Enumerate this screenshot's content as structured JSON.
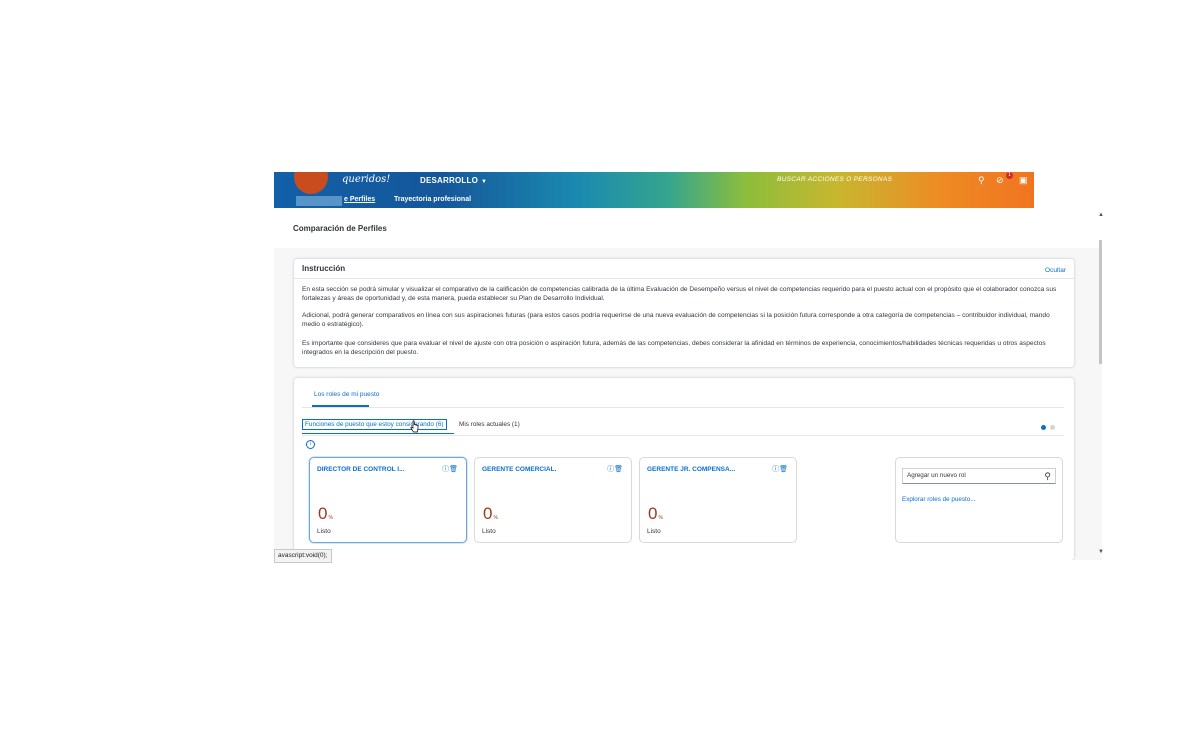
{
  "header": {
    "logo_text": "queridos!",
    "module": "DESARROLLO",
    "search_placeholder": "BUSCAR ACCIONES O PERSONAS",
    "notification_count": "1",
    "colors": {
      "accent": "#0a6ed1",
      "value": "#9b3a1e",
      "badge": "#d3282d"
    }
  },
  "subnav": {
    "tabs": [
      {
        "label": "e Perfiles"
      },
      {
        "label": "Trayectoria profesional"
      }
    ]
  },
  "page": {
    "title": "Comparación de Perfiles"
  },
  "instruction": {
    "heading": "Instrucción",
    "hide_link": "Ocultar",
    "paragraphs": [
      "En esta sección se podrá simular y visualizar el comparativo de la calificación de competencias calibrada de la última Evaluación de Desempeño versus el nivel de competencias requerido para el puesto actual con el propósito que el colaborador conozca sus fortalezas y áreas de oportunidad y, de esta manera, pueda establecer su Plan de Desarrollo Individual.",
      "Adicional, podrá generar comparativos en línea con sus aspiraciones futuras (para estos casos podría requerirse de una nueva evaluación de competencias si la posición futura corresponde a otra categoría de competencias – contribuidor individual, mando medio o estratégico).",
      "Es importante que consideres que para evaluar el nivel de ajuste con otra posición o aspiración futura, además de las competencias, debes considerar la afinidad en términos de experiencia, conocimientos/habilidades técnicas requeridas u otros aspectos integrados en la descripción del puesto."
    ]
  },
  "roles": {
    "tab": "Los roles de mi puesto",
    "segments": [
      {
        "label": "Funciones de puesto que estoy considerando (6)"
      },
      {
        "label": "Mis roles actuales (1)"
      }
    ],
    "cards": [
      {
        "title": "DIRECTOR DE CONTROL I...",
        "value": "0",
        "unit": "%",
        "status": "Listo"
      },
      {
        "title": "GERENTE COMERCIAL.",
        "value": "0",
        "unit": "%",
        "status": "Listo"
      },
      {
        "title": "GERENTE JR. COMPENSA...",
        "value": "0",
        "unit": "%",
        "status": "Listo"
      }
    ],
    "add": {
      "placeholder": "Agregar un nuevo rol",
      "explore_link": "Explorar roles de puesto..."
    }
  },
  "statusbar": {
    "url": "avascript:void(0);"
  }
}
